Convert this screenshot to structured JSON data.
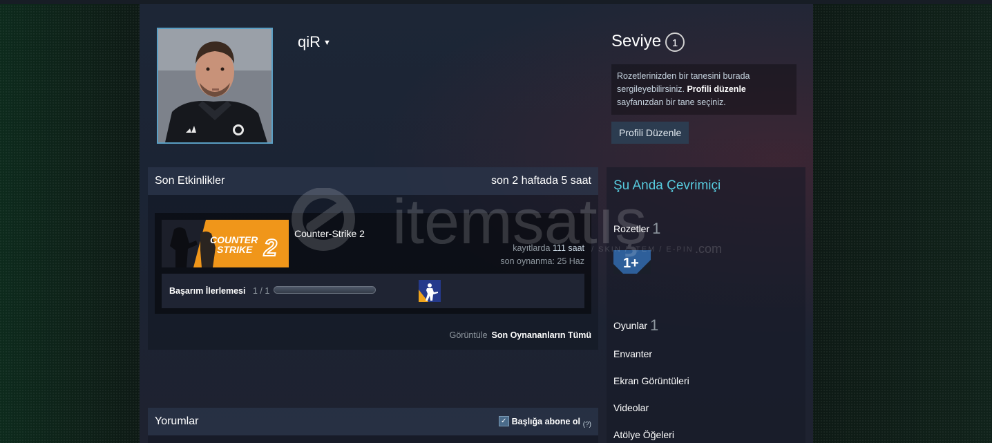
{
  "profile": {
    "persona_name": "qiR",
    "level_label": "Seviye",
    "level_value": "1",
    "badge_hint_part1": "Rozetlerinizden bir tanesini burada sergileyebilirsiniz. ",
    "badge_hint_bold": "Profili düzenle",
    "badge_hint_part2": " sayfanızdan bir tane seçiniz.",
    "edit_button": "Profili Düzenle"
  },
  "activity": {
    "title": "Son Etkinlikler",
    "summary": "son 2 haftada 5 saat",
    "game": {
      "name": "Counter-Strike 2",
      "capsule_text_line1": "COUNTER",
      "capsule_text_line2": "STRIKE",
      "capsule_number": "2",
      "hours_prefix": "kayıtlarda ",
      "hours_value": "111 saat",
      "last_played": "son oynanma: 25 Haz",
      "achievement_label": "Başarım İlerlemesi",
      "achievement_count": "1 / 1",
      "achievement_progress": 1.0
    },
    "view_label": "Görüntüle",
    "view_all_link": "Son Oynananların Tümü"
  },
  "comments": {
    "title": "Yorumlar",
    "subscribe_label": "Başlığa abone ol",
    "help": "(?)"
  },
  "sidebar": {
    "online_status": "Şu Anda Çevrimiçi",
    "badges_label": "Rozetler",
    "badges_count": "1",
    "badge_icon_text": "1+",
    "games_label": "Oyunlar",
    "games_count": "1",
    "inventory_label": "Envanter",
    "screenshots_label": "Ekran Görüntüleri",
    "videos_label": "Videolar",
    "workshop_label": "Atölye Öğeleri"
  },
  "watermark": {
    "brand": "itemsatış",
    "tagline": "/ SKIN / ITEM / E-PIN",
    "domain_suffix": ".com"
  },
  "colors": {
    "online": "#57cbde",
    "accent_orange": "#f09a1a",
    "avatar_border": "#5a9fc4"
  }
}
